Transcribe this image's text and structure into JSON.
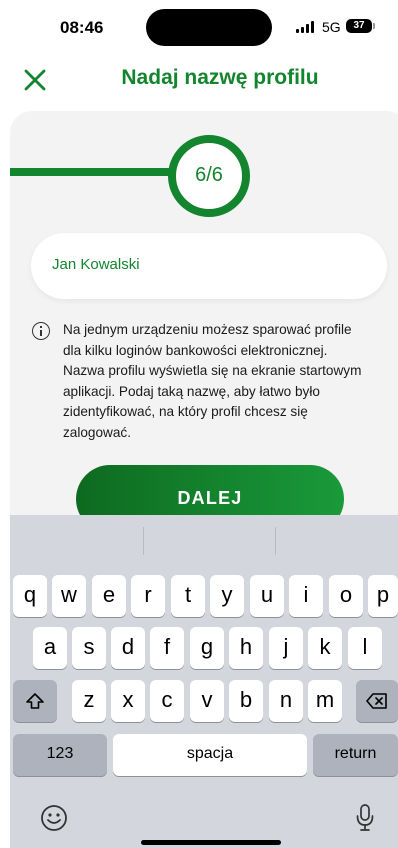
{
  "status_bar": {
    "time": "08:46",
    "network": "5G",
    "battery": "37"
  },
  "header": {
    "title": "Nadaj nazwę profilu"
  },
  "progress": {
    "label": "6/6"
  },
  "form": {
    "profile_name_value": "Jan Kowalski"
  },
  "info_text": "Na jednym urządzeniu możesz sparować profile dla kilku loginów bankowości elektronicznej. Nazwa profilu wyświetla się na ekranie startowym aplikacji.  Podaj taką nazwę, aby łatwo było zidentyfikować, na który profil chcesz się zalogować.",
  "next_button": "DALEJ",
  "keyboard": {
    "row1": [
      "q",
      "w",
      "e",
      "r",
      "t",
      "y",
      "u",
      "i",
      "o",
      "p"
    ],
    "row2": [
      "a",
      "s",
      "d",
      "f",
      "g",
      "h",
      "j",
      "k",
      "l"
    ],
    "row3": [
      "z",
      "x",
      "c",
      "v",
      "b",
      "n",
      "m"
    ],
    "numbers_key": "123",
    "space_key": "spacja",
    "return_key": "return"
  },
  "colors": {
    "brand_green": "#14852f",
    "button_green": "#0d6a20",
    "keyboard_bg": "#d4d6dd"
  }
}
